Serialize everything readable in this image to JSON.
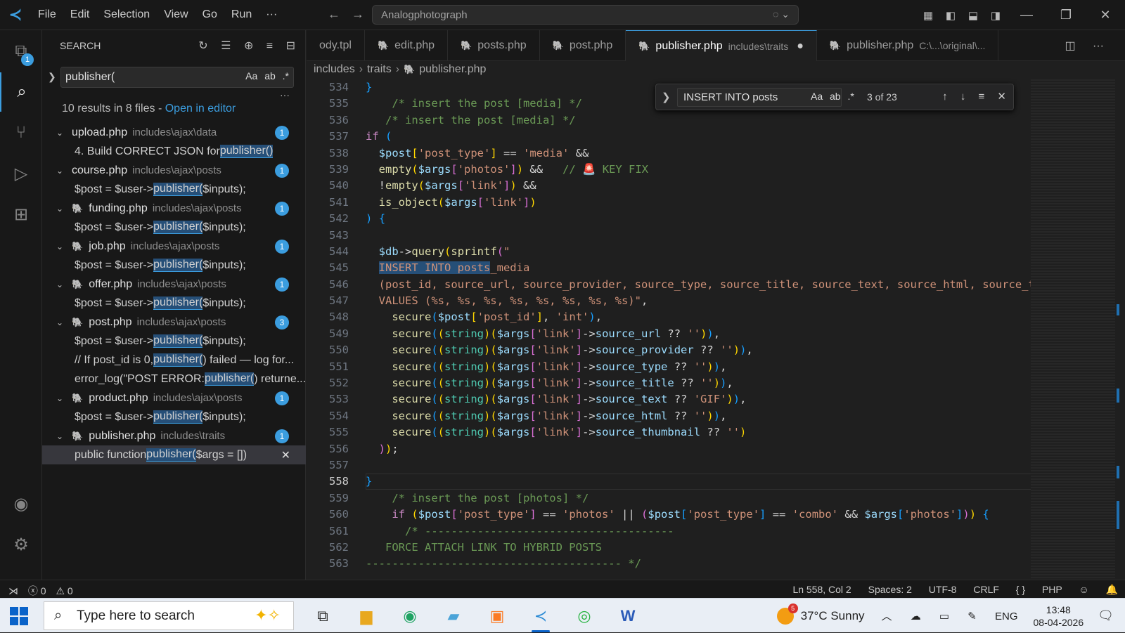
{
  "titlebar": {
    "menu": [
      "File",
      "Edit",
      "Selection",
      "View",
      "Go",
      "Run",
      "···"
    ],
    "command_center": "Analogphotograph"
  },
  "activity": {
    "explorer_badge": "1"
  },
  "sidebar": {
    "title": "SEARCH",
    "query": "publisher(",
    "opt_case": "Aa",
    "opt_word": "ab",
    "opt_regex": ".*",
    "summary_text": "10 results in 8 files - ",
    "summary_link": "Open in editor",
    "results": [
      {
        "file": "upload.php",
        "path": "includes\\ajax\\data",
        "count": "1",
        "php": false,
        "matches": [
          {
            "pre": "4. Build CORRECT JSON for ",
            "hl": "publisher()",
            "post": ""
          }
        ]
      },
      {
        "file": "course.php",
        "path": "includes\\ajax\\posts",
        "count": "1",
        "php": false,
        "matches": [
          {
            "pre": "$post = $user->",
            "hl": "publisher(",
            "post": "$inputs);"
          }
        ]
      },
      {
        "file": "funding.php",
        "path": "includes\\ajax\\posts",
        "count": "1",
        "php": true,
        "matches": [
          {
            "pre": "$post = $user->",
            "hl": "publisher(",
            "post": "$inputs);"
          }
        ]
      },
      {
        "file": "job.php",
        "path": "includes\\ajax\\posts",
        "count": "1",
        "php": true,
        "matches": [
          {
            "pre": "$post = $user->",
            "hl": "publisher(",
            "post": "$inputs);"
          }
        ]
      },
      {
        "file": "offer.php",
        "path": "includes\\ajax\\posts",
        "count": "1",
        "php": true,
        "matches": [
          {
            "pre": "$post = $user->",
            "hl": "publisher(",
            "post": "$inputs);"
          }
        ]
      },
      {
        "file": "post.php",
        "path": "includes\\ajax\\posts",
        "count": "3",
        "php": true,
        "matches": [
          {
            "pre": "$post = $user->",
            "hl": "publisher(",
            "post": "$inputs);"
          },
          {
            "pre": "// If post_id is 0, ",
            "hl": "publisher(",
            "post": ") failed — log for..."
          },
          {
            "pre": "error_log(\"POST ERROR: ",
            "hl": "publisher(",
            "post": ") returne..."
          }
        ]
      },
      {
        "file": "product.php",
        "path": "includes\\ajax\\posts",
        "count": "1",
        "php": true,
        "matches": [
          {
            "pre": "$post = $user->",
            "hl": "publisher(",
            "post": "$inputs);"
          }
        ]
      },
      {
        "file": "publisher.php",
        "path": "includes\\traits",
        "count": "1",
        "php": true,
        "matches": [
          {
            "pre": "public function ",
            "hl": "publisher(",
            "post": "$args = [])",
            "selected": true
          }
        ]
      }
    ]
  },
  "tabs": [
    {
      "label": "ody.tpl",
      "php": false,
      "active": false
    },
    {
      "label": "edit.php",
      "php": true,
      "active": false
    },
    {
      "label": "posts.php",
      "php": true,
      "active": false
    },
    {
      "label": "post.php",
      "php": true,
      "active": false
    },
    {
      "label": "publisher.php",
      "sub": "includes\\traits",
      "php": true,
      "active": true,
      "dirty": "●"
    },
    {
      "label": "publisher.php",
      "sub": "C:\\...\\original\\...",
      "php": true,
      "active": false
    }
  ],
  "breadcrumb": [
    "includes",
    "traits",
    "publisher.php"
  ],
  "find": {
    "query": "INSERT INTO posts",
    "opt_case": "Aa",
    "opt_word": "ab",
    "opt_regex": ".*",
    "count": "3 of 23"
  },
  "code": {
    "current_line": 558,
    "lines": [
      {
        "n": 534,
        "html": "<span class='br3'>}</span>"
      },
      {
        "n": 535,
        "html": "    <span class='cm'>/* insert the post [media] */</span>"
      },
      {
        "n": 536,
        "html": "   <span class='cm'>/* insert the post [media] */</span>"
      },
      {
        "n": 537,
        "html": "<span class='kw'>if</span> <span class='br3'>(</span>"
      },
      {
        "n": 538,
        "html": "  <span class='var'>$post</span><span class='br1'>[</span><span class='str'>'post_type'</span><span class='br1'>]</span> == <span class='str'>'media'</span> &amp;&amp;"
      },
      {
        "n": 539,
        "html": "  <span class='fn'>empty</span><span class='br1'>(</span><span class='var'>$args</span><span class='br2'>[</span><span class='str'>'photos'</span><span class='br2'>]</span><span class='br1'>)</span> &amp;&amp;   <span class='cm'>// </span><span style='color:#e03c31'>🚨</span><span class='cm'> KEY FIX</span>"
      },
      {
        "n": 540,
        "html": "  !<span class='fn'>empty</span><span class='br1'>(</span><span class='var'>$args</span><span class='br2'>[</span><span class='str'>'link'</span><span class='br2'>]</span><span class='br1'>)</span> &amp;&amp;"
      },
      {
        "n": 541,
        "html": "  <span class='fn'>is_object</span><span class='br1'>(</span><span class='var'>$args</span><span class='br2'>[</span><span class='str'>'link'</span><span class='br2'>]</span><span class='br1'>)</span>"
      },
      {
        "n": 542,
        "html": "<span class='br3'>)</span> <span class='br3'>{</span>"
      },
      {
        "n": 543,
        "html": ""
      },
      {
        "n": 544,
        "html": "  <span class='var'>$db</span>-&gt;<span class='fn'>query</span><span class='br1'>(</span><span class='fn'>sprintf</span><span class='br2'>(</span><span class='str'>\"</span>"
      },
      {
        "n": 545,
        "html": "  <span class='str sel'>INSERT INTO posts</span><span class='str'>_media</span>"
      },
      {
        "n": 546,
        "html": "  <span class='str'>(post_id, source_url, source_provider, source_type, source_title, source_text, source_html, source_thumbnail)</span>"
      },
      {
        "n": 547,
        "html": "  <span class='str'>VALUES (%s, %s, %s, %s, %s, %s, %s, %s)\"</span>,"
      },
      {
        "n": 548,
        "html": "    <span class='fn'>secure</span><span class='br3'>(</span><span class='var'>$post</span><span class='br1'>[</span><span class='str'>'post_id'</span><span class='br1'>]</span>, <span class='str'>'int'</span><span class='br3'>)</span>,"
      },
      {
        "n": 549,
        "html": "    <span class='fn'>secure</span><span class='br3'>(</span><span class='br1'>(</span><span class='typ'>string</span><span class='br1'>)</span><span class='br1'>(</span><span class='var'>$args</span><span class='br2'>[</span><span class='str'>'link'</span><span class='br2'>]</span>-&gt;<span class='var'>source_url</span> ?? <span class='str'>''</span><span class='br1'>)</span><span class='br3'>)</span>,"
      },
      {
        "n": 550,
        "html": "    <span class='fn'>secure</span><span class='br3'>(</span><span class='br1'>(</span><span class='typ'>string</span><span class='br1'>)</span><span class='br1'>(</span><span class='var'>$args</span><span class='br2'>[</span><span class='str'>'link'</span><span class='br2'>]</span>-&gt;<span class='var'>source_provider</span> ?? <span class='str'>''</span><span class='br1'>)</span><span class='br3'>)</span>,"
      },
      {
        "n": 551,
        "html": "    <span class='fn'>secure</span><span class='br3'>(</span><span class='br1'>(</span><span class='typ'>string</span><span class='br1'>)</span><span class='br1'>(</span><span class='var'>$args</span><span class='br2'>[</span><span class='str'>'link'</span><span class='br2'>]</span>-&gt;<span class='var'>source_type</span> ?? <span class='str'>''</span><span class='br1'>)</span><span class='br3'>)</span>,"
      },
      {
        "n": 552,
        "html": "    <span class='fn'>secure</span><span class='br3'>(</span><span class='br1'>(</span><span class='typ'>string</span><span class='br1'>)</span><span class='br1'>(</span><span class='var'>$args</span><span class='br2'>[</span><span class='str'>'link'</span><span class='br2'>]</span>-&gt;<span class='var'>source_title</span> ?? <span class='str'>''</span><span class='br1'>)</span><span class='br3'>)</span>,"
      },
      {
        "n": 553,
        "html": "    <span class='fn'>secure</span><span class='br3'>(</span><span class='br1'>(</span><span class='typ'>string</span><span class='br1'>)</span><span class='br1'>(</span><span class='var'>$args</span><span class='br2'>[</span><span class='str'>'link'</span><span class='br2'>]</span>-&gt;<span class='var'>source_text</span> ?? <span class='str'>'GIF'</span><span class='br1'>)</span><span class='br3'>)</span>,"
      },
      {
        "n": 554,
        "html": "    <span class='fn'>secure</span><span class='br3'>(</span><span class='br1'>(</span><span class='typ'>string</span><span class='br1'>)</span><span class='br1'>(</span><span class='var'>$args</span><span class='br2'>[</span><span class='str'>'link'</span><span class='br2'>]</span>-&gt;<span class='var'>source_html</span> ?? <span class='str'>''</span><span class='br1'>)</span><span class='br3'>)</span>,"
      },
      {
        "n": 555,
        "html": "    <span class='fn'>secure</span><span class='br3'>(</span><span class='br1'>(</span><span class='typ'>string</span><span class='br1'>)</span><span class='br1'>(</span><span class='var'>$args</span><span class='br2'>[</span><span class='str'>'link'</span><span class='br2'>]</span>-&gt;<span class='var'>source_thumbnail</span> ?? <span class='str'>''</span><span class='br1'>)</span>"
      },
      {
        "n": 556,
        "html": "  <span class='br2'>)</span><span class='br1'>)</span>;"
      },
      {
        "n": 557,
        "html": ""
      },
      {
        "n": 558,
        "html": "<span class='br3'>}</span>"
      },
      {
        "n": 559,
        "html": "    <span class='cm'>/* insert the post [photos] */</span>"
      },
      {
        "n": 560,
        "html": "    <span class='kw'>if</span> <span class='br1'>(</span><span class='var'>$post</span><span class='br2'>[</span><span class='str'>'post_type'</span><span class='br2'>]</span> == <span class='str'>'photos'</span> || <span class='br2'>(</span><span class='var'>$post</span><span class='br3'>[</span><span class='str'>'post_type'</span><span class='br3'>]</span> == <span class='str'>'combo'</span> &amp;&amp; <span class='var'>$args</span><span class='br3'>[</span><span class='str'>'photos'</span><span class='br3'>]</span><span class='br2'>)</span><span class='br1'>)</span> <span class='br3'>{</span>"
      },
      {
        "n": 561,
        "html": "      <span class='cm'>/* --------------------------------------</span>"
      },
      {
        "n": 562,
        "html": "   <span class='cm'>FORCE ATTACH LINK TO HYBRID POSTS</span>"
      },
      {
        "n": 563,
        "html": "<span class='cm'>--------------------------------------- */</span>"
      }
    ]
  },
  "statusbar": {
    "errors": "0",
    "warnings": "0",
    "position": "Ln 558, Col 2",
    "spaces": "Spaces: 2",
    "encoding": "UTF-8",
    "eol": "CRLF",
    "language": "PHP"
  },
  "taskbar": {
    "search_placeholder": "Type here to search",
    "weather_badge": "5",
    "weather": "37°C  Sunny",
    "lang": "ENG",
    "time": "13:48",
    "date": "08-04-2026"
  },
  "colors": {
    "accent": "#3b9ddf",
    "php_icon": "#b180d7"
  }
}
